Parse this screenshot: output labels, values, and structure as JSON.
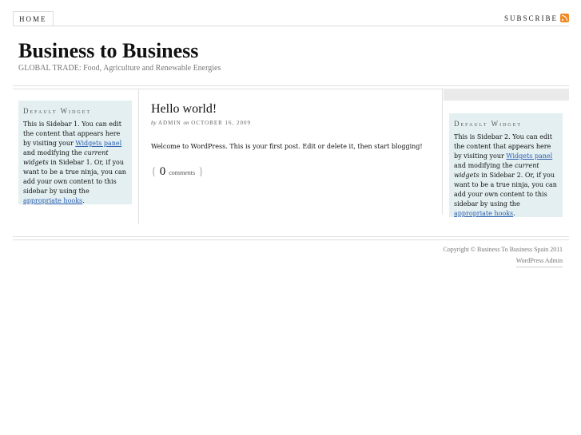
{
  "nav": {
    "home_label": "HOME",
    "subscribe_label": "SUBSCRIBE",
    "rss_icon": "rss-icon",
    "rss_color": "#f08a24"
  },
  "header": {
    "title": "Business to Business",
    "description": "GLOBAL TRADE: Food, Agriculture and Renewable Energies"
  },
  "sidebar1": {
    "title": "Default Widget",
    "text_1": "This is Sidebar 1. You can edit the content that appears here by visiting your ",
    "link_1": "Widgets panel",
    "text_2": " and modifying the ",
    "em_1": "current widgets",
    "text_3": " in Sidebar 1. Or, if you want to be a true ninja, you can add your own content to this sidebar by using the ",
    "link_2": "appropriate hooks",
    "text_4": "."
  },
  "sidebar2": {
    "title": "Default Widget",
    "text_1": "This is Sidebar 2. You can edit the content that appears here by visiting your ",
    "link_1": "Widgets panel",
    "text_2": " and modifying the ",
    "em_1": "current widgets",
    "text_3": " in Sidebar 2. Or, if you want to be a true ninja, you can add your own content to this sidebar by using the ",
    "link_2": "appropriate hooks",
    "text_4": "."
  },
  "post": {
    "title": "Hello world!",
    "meta_by": "by",
    "author": "ADMIN",
    "meta_on": "on",
    "date": "OCTOBER 16, 2009",
    "body": "Welcome to WordPress. This is your first post. Edit or delete it, then start blogging!",
    "comment_open": "{",
    "comment_count": "0",
    "comment_word": "comments",
    "comment_close": "}"
  },
  "footer": {
    "copyright": "Copyright © Business To Business Spain 2011",
    "admin_link": "WordPress Admin"
  },
  "colors": {
    "widget_bg": "#e3eff0",
    "link": "#2a5db0",
    "rule": "#e0e0e0"
  }
}
